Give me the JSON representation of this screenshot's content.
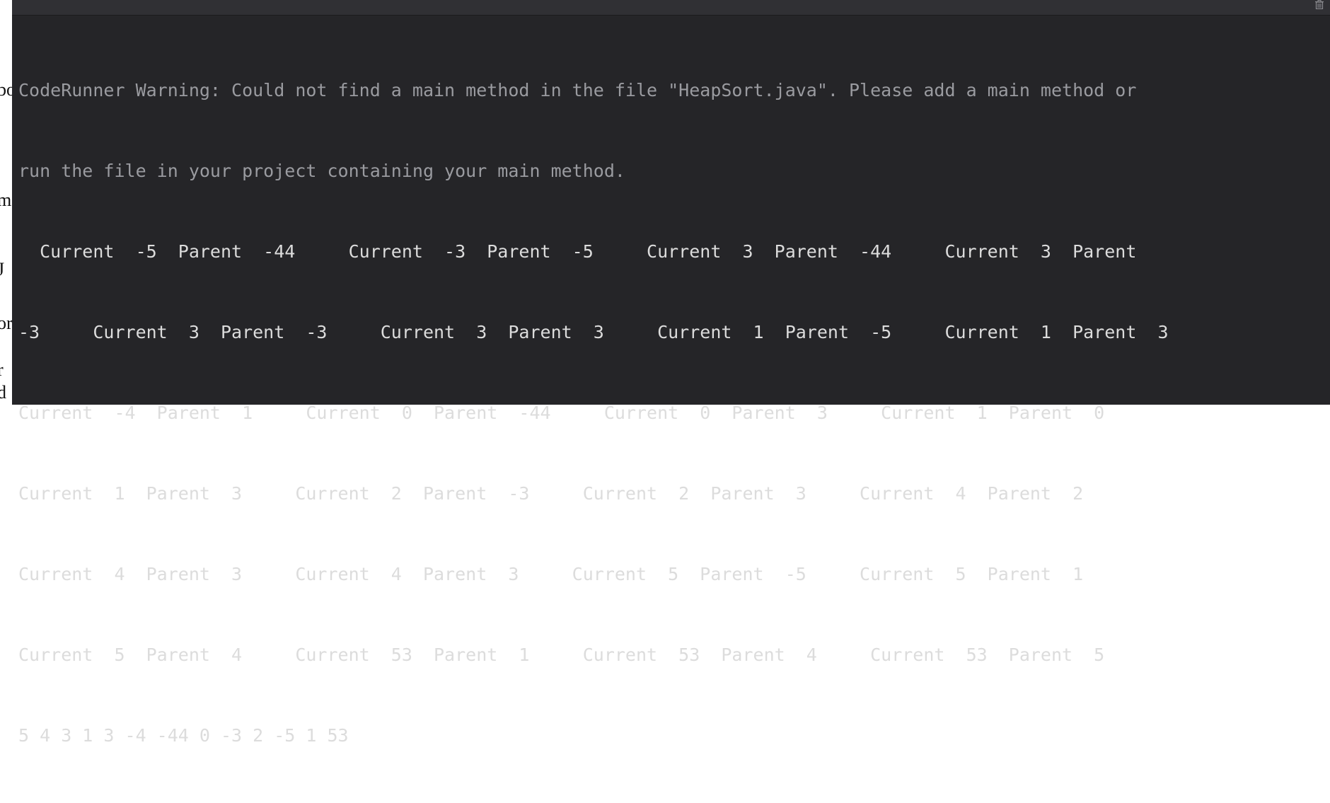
{
  "background_fragments": [
    "bo",
    "m",
    "J",
    "or",
    "r",
    "d"
  ],
  "output_panel": {
    "clear_icon": "trash-icon",
    "warning_lines": [
      "CodeRunner Warning: Could not find a main method in the file \"HeapSort.java\". Please add a main method or",
      "run the file in your project containing your main method."
    ],
    "output_lines": [
      "  Current  -5  Parent  -44     Current  -3  Parent  -5     Current  3  Parent  -44     Current  3  Parent",
      "-3     Current  3  Parent  -3     Current  3  Parent  3     Current  1  Parent  -5     Current  1  Parent  3",
      "Current  -4  Parent  1     Current  0  Parent  -44     Current  0  Parent  3     Current  1  Parent  0",
      "Current  1  Parent  3     Current  2  Parent  -3     Current  2  Parent  3     Current  4  Parent  2",
      "Current  4  Parent  3     Current  4  Parent  3     Current  5  Parent  -5     Current  5  Parent  1",
      "Current  5  Parent  4     Current  53  Parent  1     Current  53  Parent  4     Current  53  Parent  5",
      "5 4 3 1 3 -4 -44 0 -3 2 -5 1 53"
    ]
  }
}
